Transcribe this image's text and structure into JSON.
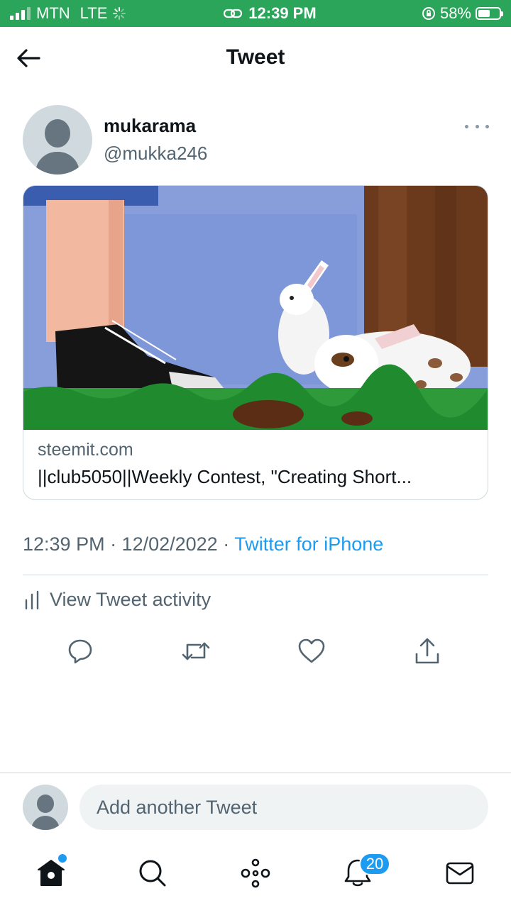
{
  "status_bar": {
    "carrier": "MTN",
    "network": "LTE",
    "time": "12:39 PM",
    "battery": "58%",
    "battery_level": 0.58
  },
  "header": {
    "title": "Tweet"
  },
  "tweet": {
    "display_name": "mukarama",
    "handle": "@mukka246",
    "card": {
      "domain": "steemit.com",
      "title": "||club5050||Weekly Contest, \"Creating Short..."
    },
    "timestamp": "12:39 PM · 12/02/2022 · ",
    "source": "Twitter for iPhone",
    "activity_label": "View Tweet activity"
  },
  "reply": {
    "placeholder": "Add another Tweet"
  },
  "tabbar": {
    "notifications_badge": "20"
  },
  "colors": {
    "accent": "#1d9bf0",
    "status_bar": "#2aa55a",
    "secondary_text": "#536471"
  },
  "icons": [
    "back-arrow-icon",
    "more-icon",
    "stats-icon",
    "reply-icon",
    "retweet-icon",
    "like-icon",
    "share-icon",
    "home-icon",
    "search-icon",
    "spaces-icon",
    "notifications-icon",
    "messages-icon"
  ]
}
